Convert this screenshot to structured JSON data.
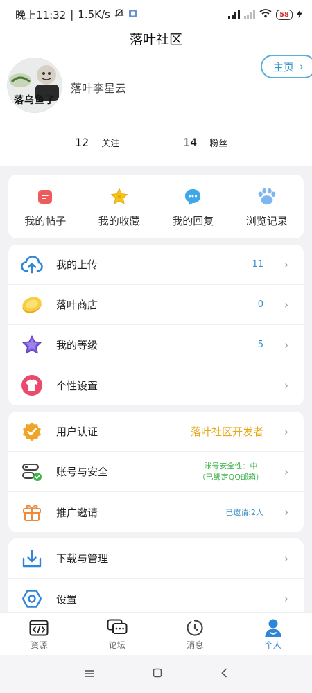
{
  "status_bar": {
    "time": "晚上11:32",
    "speed": "1.5K/s",
    "network": "HD",
    "battery": "58"
  },
  "header": {
    "title": "落叶社区",
    "avatar_text": "落乌鱼了",
    "username": "落叶李星云",
    "home_button": "主页",
    "following_count": "12",
    "following_label": "关注",
    "followers_count": "14",
    "followers_label": "粉丝"
  },
  "quick_actions": [
    {
      "label": "我的帖子",
      "icon": "post-icon",
      "color": "#ef5a5a"
    },
    {
      "label": "我的收藏",
      "icon": "star-icon",
      "color": "#f5c518"
    },
    {
      "label": "我的回复",
      "icon": "chat-bubble-icon",
      "color": "#3ea7e8"
    },
    {
      "label": "浏览记录",
      "icon": "paw-icon",
      "color": "#7fb6f0"
    }
  ],
  "group1": [
    {
      "label": "我的上传",
      "value": "11",
      "icon": "cloud-upload-icon"
    },
    {
      "label": "落叶商店",
      "value": "0",
      "icon": "coin-icon"
    },
    {
      "label": "我的等级",
      "value": "5",
      "icon": "level-star-icon"
    },
    {
      "label": "个性设置",
      "value": "",
      "icon": "shirt-icon"
    }
  ],
  "group2": [
    {
      "label": "用户认证",
      "value": "落叶社区开发者",
      "icon": "verified-badge-icon"
    },
    {
      "label": "账号与安全",
      "value_line1": "账号安全性：中",
      "value_line2": "（已绑定QQ邮箱）",
      "icon": "security-icon"
    },
    {
      "label": "推广邀请",
      "value": "已邀请:2人",
      "icon": "gift-icon"
    }
  ],
  "group3": [
    {
      "label": "下载与管理",
      "icon": "download-icon"
    },
    {
      "label": "设置",
      "icon": "settings-hexagon-icon"
    }
  ],
  "bottom_nav": [
    {
      "label": "资源",
      "icon": "code-icon"
    },
    {
      "label": "论坛",
      "icon": "forum-icon"
    },
    {
      "label": "消息",
      "icon": "message-icon"
    },
    {
      "label": "个人",
      "icon": "person-icon",
      "active": true
    }
  ],
  "colors": {
    "accent": "#2f86d6",
    "home_border": "#58b1d8",
    "gold": "#e6a817",
    "green": "#3eb34a"
  }
}
